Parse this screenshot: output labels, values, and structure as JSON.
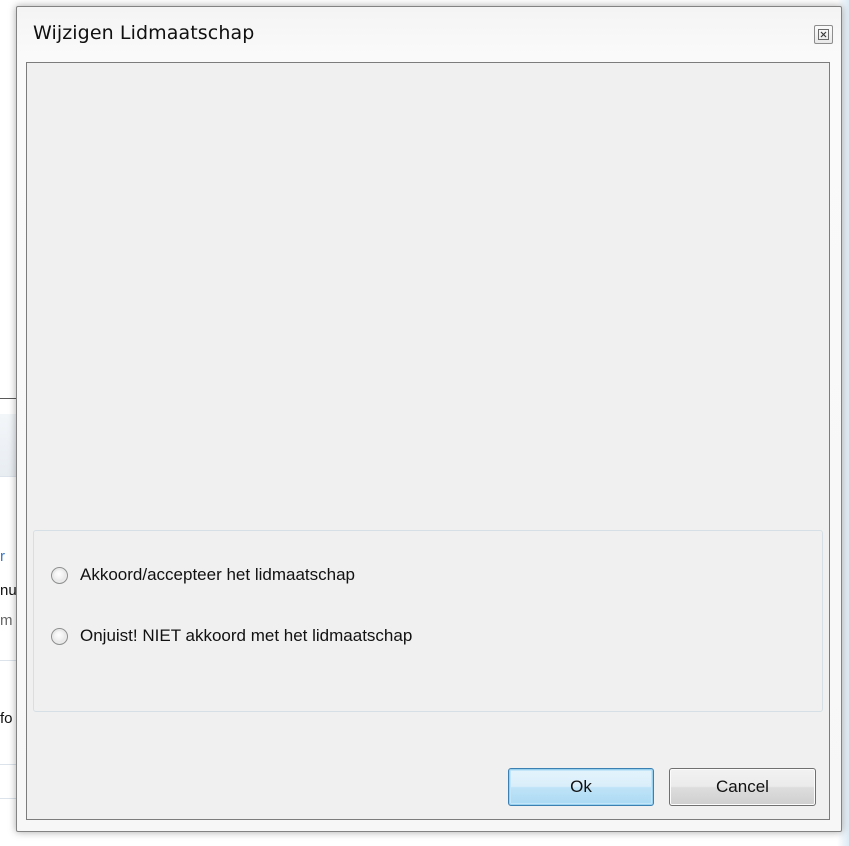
{
  "background": {
    "fragments": [
      {
        "name": "bg-text-r",
        "text": "r"
      },
      {
        "name": "bg-text-nu",
        "text": "nu"
      },
      {
        "name": "bg-text-m",
        "text": "m"
      },
      {
        "name": "bg-text-fo",
        "text": "fo"
      }
    ]
  },
  "dialog": {
    "title": "Wijzigen Lidmaatschap",
    "close_icon": "close-icon",
    "options": [
      {
        "label": "Akkoord/accepteer het lidmaatschap",
        "selected": false
      },
      {
        "label": "Onjuist! NIET akkoord met het lidmaatschap",
        "selected": false
      }
    ],
    "buttons": {
      "ok": "Ok",
      "cancel": "Cancel"
    }
  },
  "colors": {
    "ok_button_border": "#3c7fb1",
    "ok_button_fill": "#bfe3f7",
    "dialog_background": "#f0f0f0"
  }
}
